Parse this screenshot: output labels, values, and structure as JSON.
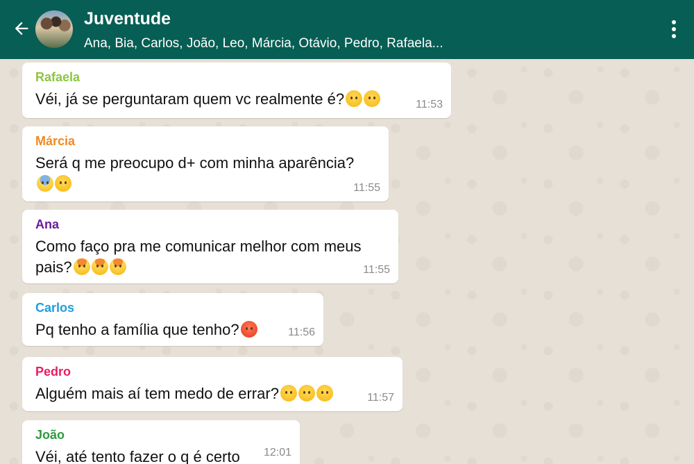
{
  "header": {
    "back_icon": "arrow-left-icon",
    "group_name": "Juventude",
    "members": "Ana, Bia, Carlos, João, Leo, Márcia, Otávio, Pedro, Rafaela...",
    "menu_icon": "more-vertical-icon",
    "color": "#075e54"
  },
  "messages": [
    {
      "sender": "Rafaela",
      "color": "#8cc63e",
      "text": "Véi, já se perguntaram quem vc realmente é?",
      "emojis": [
        "thinking-face",
        "thinking-face"
      ],
      "time": "11:53"
    },
    {
      "sender": "Márcia",
      "color": "#f08a24",
      "text": "Será q me preocupo d+ com minha aparência?",
      "emojis": [
        "sweat-face",
        "pensive-face"
      ],
      "time": "11:55"
    },
    {
      "sender": "Ana",
      "color": "#6a1b9a",
      "text": "Como faço pra me comunicar melhor com meus pais?",
      "emojis": [
        "exploding-head",
        "exploding-head",
        "exploding-head"
      ],
      "time": "11:55"
    },
    {
      "sender": "Carlos",
      "color": "#1e9fdd",
      "text": "Pq tenho a família que tenho?",
      "emojis": [
        "angry-face"
      ],
      "time": "11:56"
    },
    {
      "sender": "Pedro",
      "color": "#e91e63",
      "text": "Alguém mais aí tem medo de errar?",
      "emojis": [
        "frowning-face",
        "frowning-face",
        "frowning-face"
      ],
      "time": "11:57"
    },
    {
      "sender": "João",
      "color": "#2e9a3c",
      "text": "Véi, até tento fazer o q é certo",
      "emojis": [],
      "time": "12:01"
    }
  ]
}
